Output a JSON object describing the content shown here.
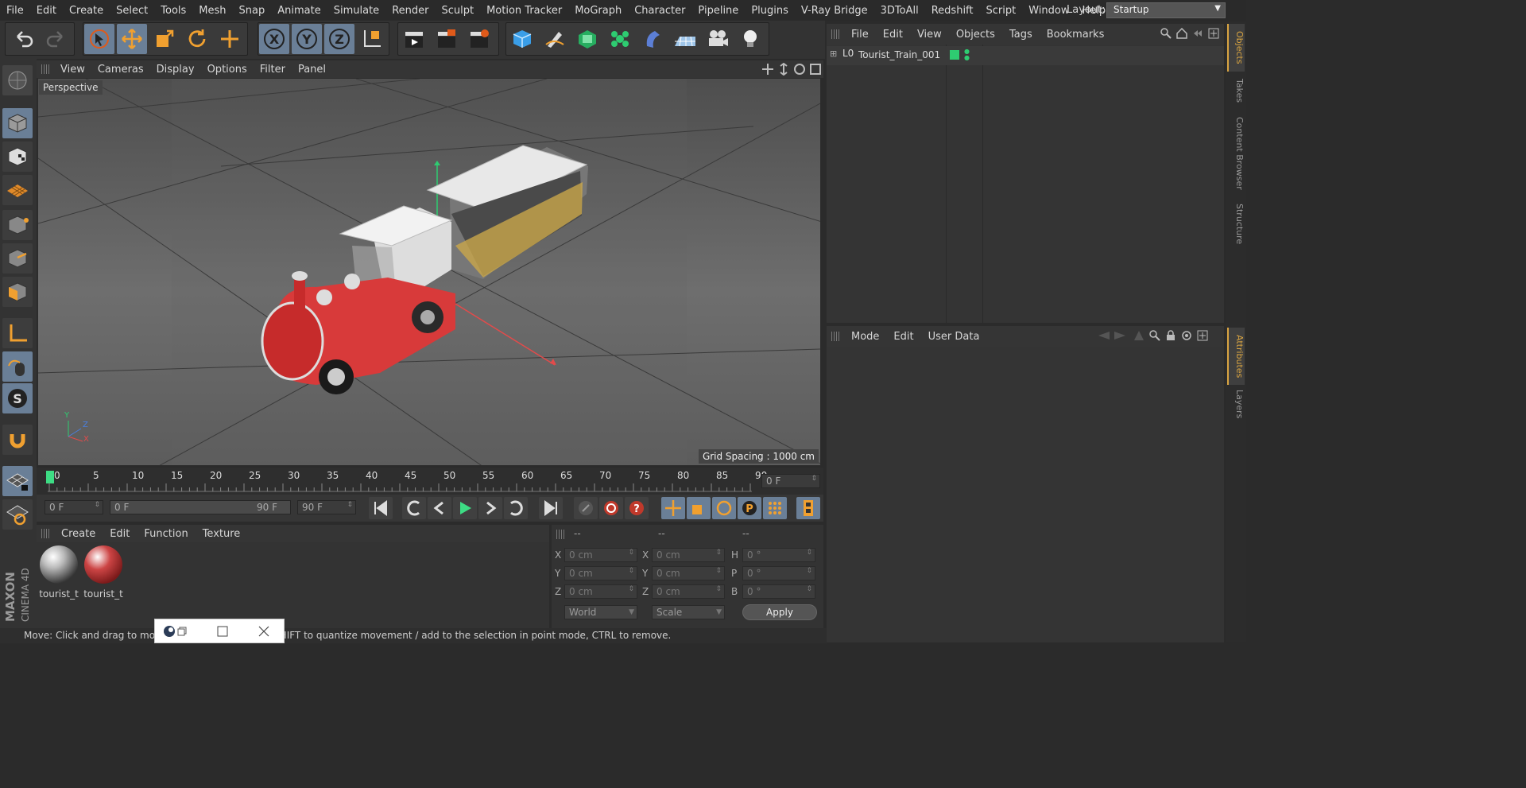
{
  "menubar": {
    "items": [
      "File",
      "Edit",
      "Create",
      "Select",
      "Tools",
      "Mesh",
      "Snap",
      "Animate",
      "Simulate",
      "Render",
      "Sculpt",
      "Motion Tracker",
      "MoGraph",
      "Character",
      "Pipeline",
      "Plugins",
      "V-Ray Bridge",
      "3DToAll",
      "Redshift",
      "Script",
      "Window",
      "Help"
    ],
    "layout_label": "Layout:",
    "layout_value": "Startup"
  },
  "viewport": {
    "menu": [
      "View",
      "Cameras",
      "Display",
      "Options",
      "Filter",
      "Panel"
    ],
    "label": "Perspective",
    "grid_spacing": "Grid Spacing : 1000 cm",
    "axis_y": "Y",
    "axis_z": "Z",
    "axis_x": "X"
  },
  "timeline": {
    "ticks": [
      "0",
      "5",
      "10",
      "15",
      "20",
      "25",
      "30",
      "35",
      "40",
      "45",
      "50",
      "55",
      "60",
      "65",
      "70",
      "75",
      "80",
      "85",
      "90"
    ],
    "current_frame": "0 F"
  },
  "transport": {
    "start_frame": "0 F",
    "range_start": "0 F",
    "range_end": "90 F",
    "end_frame": "90 F"
  },
  "materials": {
    "menu": [
      "Create",
      "Edit",
      "Function",
      "Texture"
    ],
    "items": [
      {
        "name": "tourist_t"
      },
      {
        "name": "tourist_t"
      }
    ]
  },
  "coords": {
    "headers": [
      "--",
      "--",
      "--"
    ],
    "pos_labels": [
      "X",
      "Y",
      "Z"
    ],
    "pos_values": [
      "0 cm",
      "0 cm",
      "0 cm"
    ],
    "size_labels": [
      "X",
      "Y",
      "Z"
    ],
    "size_values": [
      "0 cm",
      "0 cm",
      "0 cm"
    ],
    "rot_labels": [
      "H",
      "P",
      "B"
    ],
    "rot_values": [
      "0 °",
      "0 °",
      "0 °"
    ],
    "mode_world": "World",
    "mode_scale": "Scale",
    "apply": "Apply"
  },
  "objects": {
    "menu": [
      "File",
      "Edit",
      "View",
      "Objects",
      "Tags",
      "Bookmarks"
    ],
    "items": [
      {
        "name": "Tourist_Train_001"
      }
    ]
  },
  "attributes": {
    "menu": [
      "Mode",
      "Edit",
      "User Data"
    ]
  },
  "sidetabs": {
    "top": [
      "Objects",
      "Takes",
      "Content Browser",
      "Structure"
    ],
    "bottom": [
      "Attributes",
      "Layers"
    ]
  },
  "status": "Move: Click and drag to move elements. Hold down SHIFT to quantize movement / add to the selection in point mode, CTRL to remove.",
  "logo": {
    "line1": "MAXON",
    "line2": "CINEMA 4D"
  },
  "colors": {
    "accent": "#6a7f97",
    "orange": "#f0a030",
    "green": "#2ecc71",
    "playhead": "#3ddc84"
  }
}
